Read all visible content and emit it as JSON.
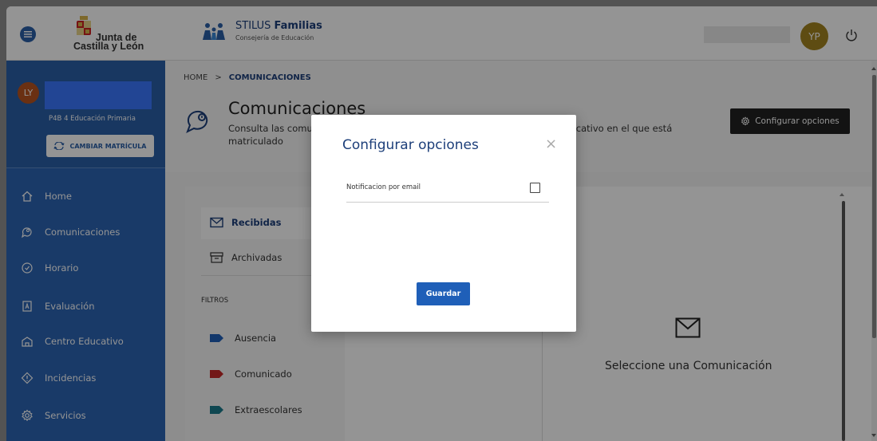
{
  "header": {
    "brand_line1": "Junta de",
    "brand_line2": "Castilla y León",
    "app_name_prefix": "STILUS ",
    "app_name_bold": "Familias",
    "app_subtitle": "Consejería de Educación",
    "user_initials": "YP"
  },
  "sidebar": {
    "user_initials": "LY",
    "course": "P4B 4 Educación Primaria",
    "change_enrollment_label": "CAMBIAR MATRÍCULA",
    "items": [
      {
        "label": "Home",
        "icon": "home-icon"
      },
      {
        "label": "Comunicaciones",
        "icon": "chat-icon"
      },
      {
        "label": "Horario",
        "icon": "clock-icon"
      },
      {
        "label": "Evaluación",
        "icon": "grade-icon"
      },
      {
        "label": "Centro Educativo",
        "icon": "school-icon"
      },
      {
        "label": "Incidencias",
        "icon": "warning-icon"
      },
      {
        "label": "Servicios",
        "icon": "gear-icon"
      }
    ]
  },
  "breadcrumb": {
    "home": "HOME",
    "separator": ">",
    "current": "COMUNICACIONES"
  },
  "page": {
    "title": "Comunicaciones",
    "desc_start": "Consulta las comu",
    "desc_end": "cativo en el que está",
    "desc_line2": "matriculado",
    "configure_button": "Configurar opciones"
  },
  "mailbox": {
    "tabs": [
      {
        "label": "Recibidas",
        "active": true
      },
      {
        "label": "Archivadas",
        "active": false
      }
    ],
    "filters_heading": "FILTROS",
    "filters": [
      {
        "label": "Ausencia",
        "color": "#1f5fb8"
      },
      {
        "label": "Comunicado",
        "color": "#c62828"
      },
      {
        "label": "Extraescolares",
        "color": "#1b7a8c"
      }
    ],
    "empty_message": "Seleccione una Comunicación"
  },
  "modal": {
    "title": "Configurar opciones",
    "close_symbol": "×",
    "option_label": "Notificacion por email",
    "option_checked": false,
    "save_button": "Guardar"
  },
  "colors": {
    "primary": "#2c64b3",
    "dark_button": "#222222",
    "avatar_yp": "#a3831f",
    "avatar_ly": "#b7541f"
  }
}
